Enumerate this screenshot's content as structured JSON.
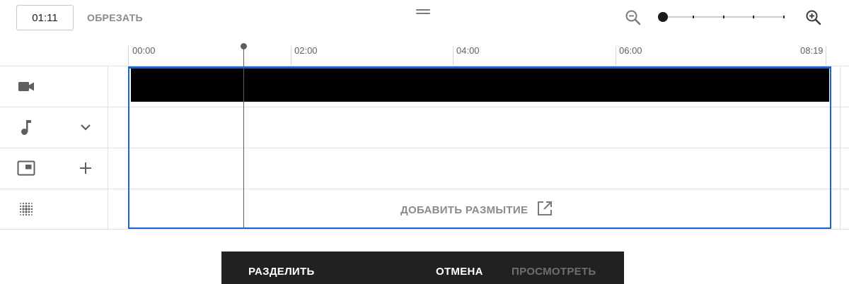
{
  "toolbar": {
    "current_time": "01:11",
    "trim_label": "ОБРЕЗАТЬ",
    "zoom_out_icon": "zoom-out-icon",
    "zoom_in_icon": "zoom-in-icon"
  },
  "ruler": {
    "labels": [
      "00:00",
      "02:00",
      "04:00",
      "06:00",
      "08:19"
    ]
  },
  "tracks": [
    {
      "type": "video",
      "icon": "videocam-icon"
    },
    {
      "type": "audio",
      "icon": "music-note-icon",
      "action_icon": "chevron-down-icon"
    },
    {
      "type": "overlay",
      "icon": "picture-in-picture-icon",
      "action_icon": "plus-icon"
    },
    {
      "type": "blur",
      "icon": "blur-icon"
    }
  ],
  "blur_action": {
    "label": "ДОБАВИТЬ РАЗМЫТИЕ",
    "icon": "open-in-new-icon"
  },
  "bottom_bar": {
    "split_label": "РАЗДЕЛИТЬ",
    "cancel_label": "ОТМЕНА",
    "preview_label": "ПРОСМОТРЕТЬ"
  },
  "colors": {
    "selection": "#1565d8",
    "bar_background": "#212121"
  }
}
